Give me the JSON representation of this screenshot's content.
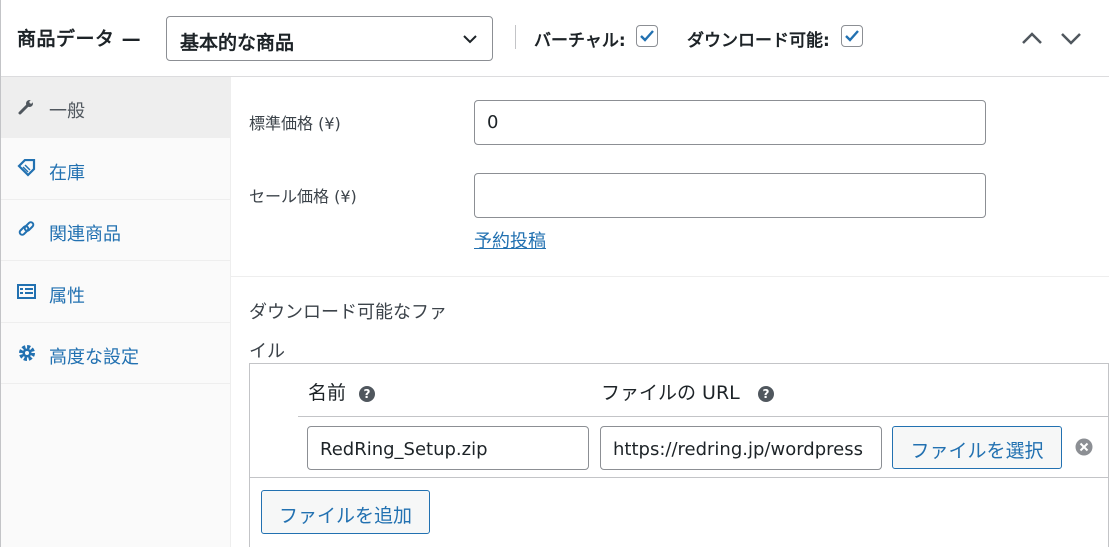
{
  "header": {
    "title": "商品データ —",
    "product_type": "基本的な商品",
    "virtual_label": "バーチャル:",
    "virtual_checked": true,
    "downloadable_label": "ダウンロード可能:",
    "downloadable_checked": true
  },
  "tabs": [
    {
      "label": "一般",
      "icon": "wrench-icon",
      "active": true
    },
    {
      "label": "在庫",
      "icon": "tag-icon",
      "active": false
    },
    {
      "label": "関連商品",
      "icon": "link-icon",
      "active": false
    },
    {
      "label": "属性",
      "icon": "list-table-icon",
      "active": false
    },
    {
      "label": "高度な設定",
      "icon": "gear-icon",
      "active": false
    }
  ],
  "general": {
    "regular_price_label": "標準価格 (¥)",
    "regular_price_value": "0",
    "sale_price_label": "セール価格 (¥)",
    "sale_price_value": "",
    "schedule_link": "予約投稿"
  },
  "downloads": {
    "label_line1": "ダウンロード可能なファ",
    "label_line2": "イル",
    "col_name": "名前",
    "col_url": "ファイルの URL",
    "help_glyph": "?",
    "files": [
      {
        "name": "RedRing_Setup.zip",
        "url": "https://redring.jp/wordpress"
      }
    ],
    "choose_file_button": "ファイルを選択",
    "add_file_button": "ファイルを追加"
  },
  "colors": {
    "accent": "#2271b1",
    "border": "#c3c4c7",
    "tab_bg": "#fafafa",
    "tab_active_bg": "#eeeeee"
  }
}
